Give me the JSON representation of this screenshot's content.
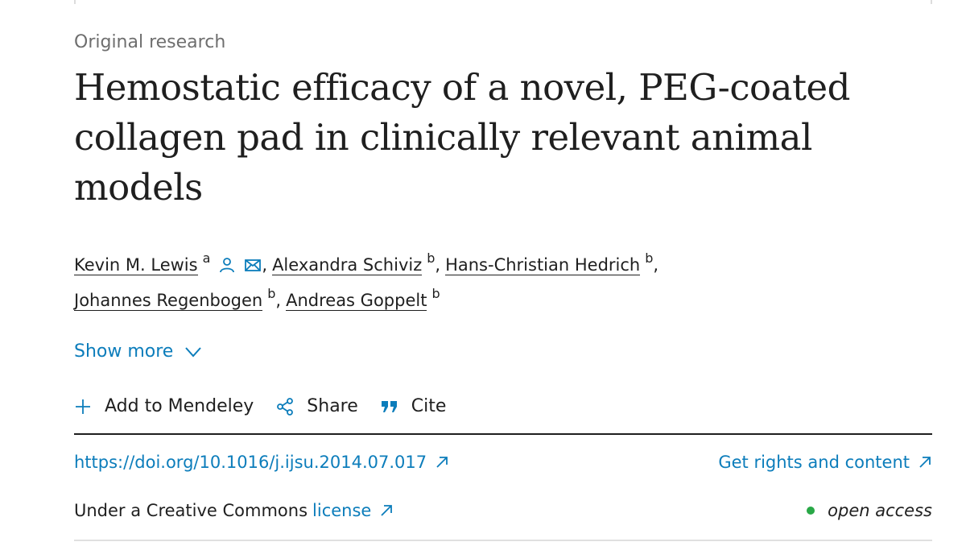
{
  "article": {
    "type": "Original research",
    "title": "Hemostatic efficacy of a novel, PEG-coated collagen pad in clinically relevant animal models"
  },
  "authors": [
    {
      "name": "Kevin M. Lewis",
      "aff": "a"
    },
    {
      "name": "Alexandra Schiviz",
      "aff": "b"
    },
    {
      "name": "Hans-Christian Hedrich",
      "aff": "b"
    },
    {
      "name": "Johannes Regenbogen",
      "aff": "b"
    },
    {
      "name": "Andreas Goppelt",
      "aff": "b"
    }
  ],
  "separators": {
    "comma": ","
  },
  "show_more": {
    "label": "Show more"
  },
  "actions": {
    "mendeley": "Add to Mendeley",
    "share": "Share",
    "cite": "Cite"
  },
  "links": {
    "doi": "https://doi.org/10.1016/j.ijsu.2014.07.017",
    "rights": "Get rights and content"
  },
  "license": {
    "prefix": "Under a Creative Commons",
    "link": "license",
    "access": "open access"
  },
  "colors": {
    "link": "#0c7dbb",
    "text": "#1f1f1f",
    "muted": "#6e6e6e",
    "open_access": "#29a847"
  }
}
